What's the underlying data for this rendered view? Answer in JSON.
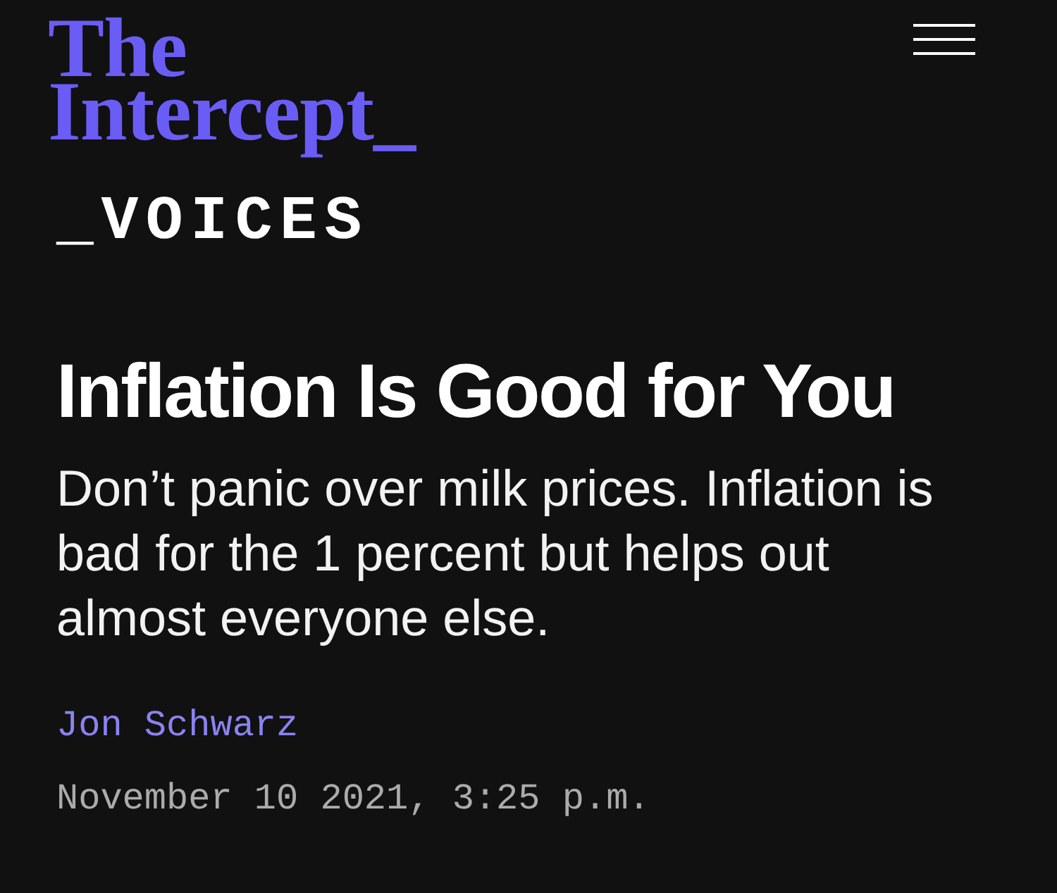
{
  "header": {
    "logo": "The Intercept_"
  },
  "section_label": "_VOICES",
  "article": {
    "title": "Inflation Is Good for You",
    "subtitle": "Don’t panic over milk prices. Inflation is bad for the 1 percent but helps out almost everyone else.",
    "author": "Jon Schwarz",
    "date": "November 10 2021, 3:25 p.m."
  }
}
